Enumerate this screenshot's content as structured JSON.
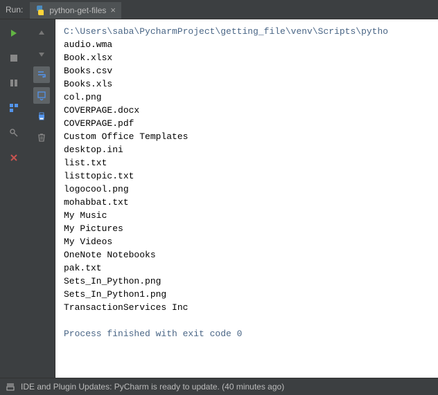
{
  "header": {
    "run_label": "Run:",
    "tab_name": "python-get-files"
  },
  "console": {
    "path": "C:\\Users\\saba\\PycharmProject\\getting_file\\venv\\Scripts\\pytho",
    "lines": [
      "audio.wma",
      "Book.xlsx",
      "Books.csv",
      "Books.xls",
      "col.png",
      "COVERPAGE.docx",
      "COVERPAGE.pdf",
      "Custom Office Templates",
      "desktop.ini",
      "list.txt",
      "listtopic.txt",
      "logocool.png",
      "mohabbat.txt",
      "My Music",
      "My Pictures",
      "My Videos",
      "OneNote Notebooks",
      "pak.txt",
      "Sets_In_Python.png",
      "Sets_In_Python1.png",
      "TransactionServices Inc"
    ],
    "exit_message": "Process finished with exit code 0"
  },
  "statusbar": {
    "message": "IDE and Plugin Updates: PyCharm is ready to update. (40 minutes ago)"
  },
  "colors": {
    "bg_dark": "#3c3f41",
    "console_bg": "#ffffff",
    "path_color": "#4a6686"
  }
}
